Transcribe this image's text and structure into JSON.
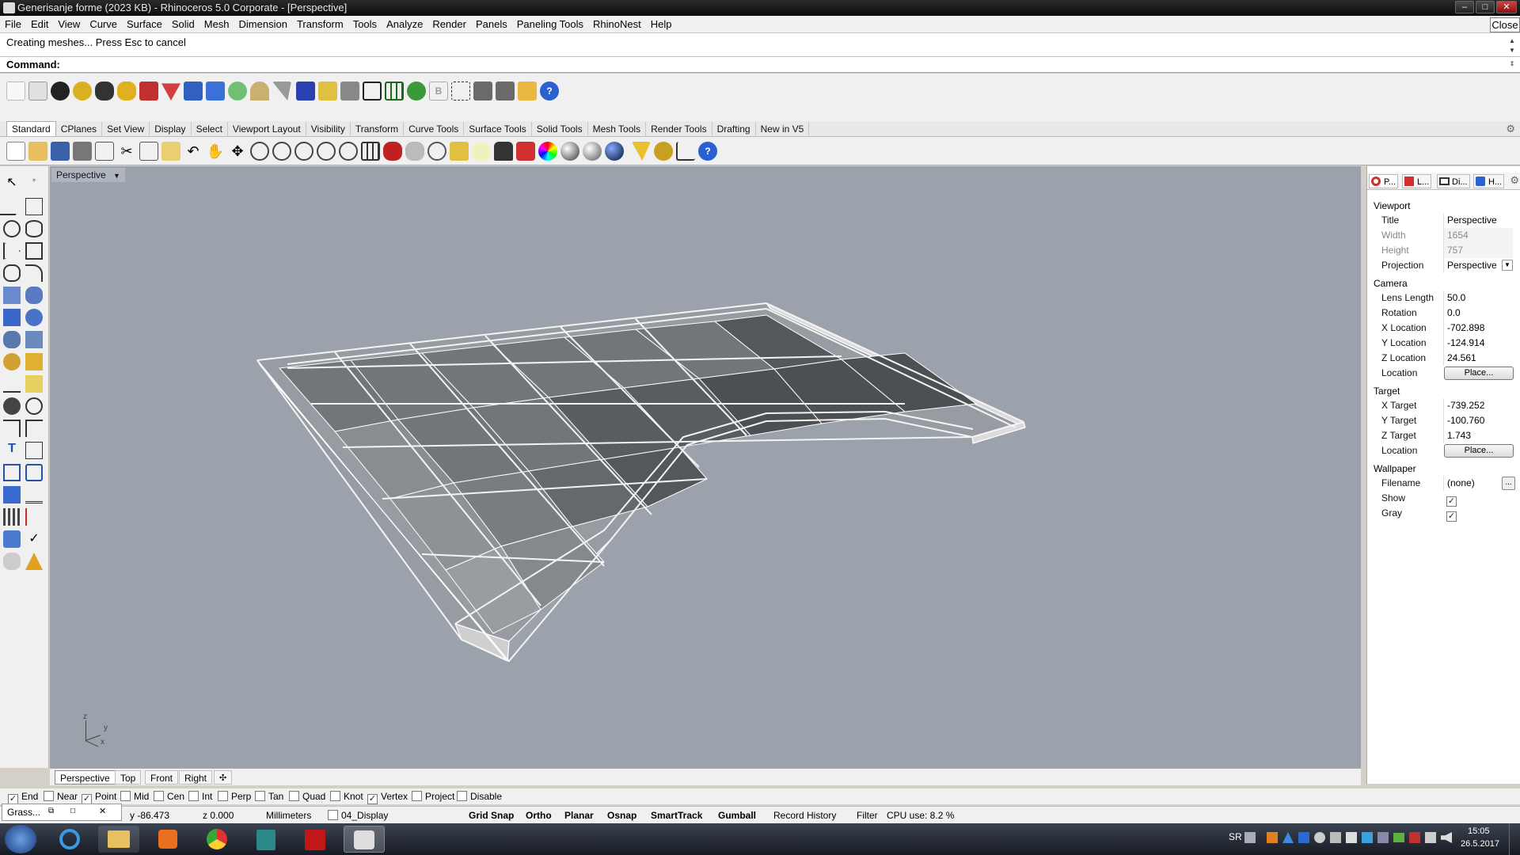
{
  "window": {
    "title": "Generisanje forme (2023 KB) - Rhinoceros  5.0 Corporate - [Perspective]",
    "close_tab_label": "Close"
  },
  "menu": [
    "File",
    "Edit",
    "View",
    "Curve",
    "Surface",
    "Solid",
    "Mesh",
    "Dimension",
    "Transform",
    "Tools",
    "Analyze",
    "Render",
    "Panels",
    "Paneling Tools",
    "RhinoNest",
    "Help"
  ],
  "command": {
    "history": "Creating meshes... Press Esc to cancel",
    "prompt": "Command:",
    "value": ""
  },
  "toolbar_tabs": [
    "Standard",
    "CPlanes",
    "Set View",
    "Display",
    "Select",
    "Viewport Layout",
    "Visibility",
    "Transform",
    "Curve Tools",
    "Surface Tools",
    "Solid Tools",
    "Mesh Tools",
    "Render Tools",
    "Drafting",
    "New in V5"
  ],
  "viewport": {
    "label": "Perspective",
    "axis_z": "z",
    "axis_y": "y",
    "axis_x": "x",
    "background": "#9ba2ab"
  },
  "viewport_tabs": [
    "Perspective",
    "Top",
    "Front",
    "Right"
  ],
  "osnap": [
    {
      "label": "End",
      "checked": true
    },
    {
      "label": "Near",
      "checked": false
    },
    {
      "label": "Point",
      "checked": true
    },
    {
      "label": "Mid",
      "checked": false
    },
    {
      "label": "Cen",
      "checked": false
    },
    {
      "label": "Int",
      "checked": false
    },
    {
      "label": "Perp",
      "checked": false
    },
    {
      "label": "Tan",
      "checked": false
    },
    {
      "label": "Quad",
      "checked": false
    },
    {
      "label": "Knot",
      "checked": false
    },
    {
      "label": "Vertex",
      "checked": true
    },
    {
      "label": "Project",
      "checked": false
    },
    {
      "label": "Disable",
      "checked": false
    }
  ],
  "status": {
    "popup_label": "Grass...",
    "y": "y -86.473",
    "z": "z 0.000",
    "units": "Millimeters",
    "layer": "04_Display",
    "toggles": [
      "Grid Snap",
      "Ortho",
      "Planar",
      "Osnap",
      "SmartTrack",
      "Gumball"
    ],
    "record_history": "Record History",
    "filter": "Filter",
    "cpu": "CPU use: 8.2 %"
  },
  "panel": {
    "tabs": [
      "P...",
      "L...",
      "Di...",
      "H..."
    ],
    "viewport_section": "Viewport",
    "title_label": "Title",
    "title_value": "Perspective",
    "width_label": "Width",
    "width_value": "1654",
    "height_label": "Height",
    "height_value": "757",
    "projection_label": "Projection",
    "projection_value": "Perspective",
    "camera_section": "Camera",
    "lens_label": "Lens Length",
    "lens_value": "50.0",
    "rotation_label": "Rotation",
    "rotation_value": "0.0",
    "xloc_label": "X Location",
    "xloc_value": "-702.898",
    "yloc_label": "Y Location",
    "yloc_value": "-124.914",
    "zloc_label": "Z Location",
    "zloc_value": "24.561",
    "location_label": "Location",
    "place_label": "Place...",
    "target_section": "Target",
    "xt_label": "X Target",
    "xt_value": "-739.252",
    "yt_label": "Y Target",
    "yt_value": "-100.760",
    "zt_label": "Z Target",
    "zt_value": "1.743",
    "wallpaper_section": "Wallpaper",
    "filename_label": "Filename",
    "filename_value": "(none)",
    "browse_label": "...",
    "show_label": "Show",
    "gray_label": "Gray"
  },
  "tray": {
    "lang": "SR",
    "time": "15:05",
    "date": "26.5.2017"
  }
}
